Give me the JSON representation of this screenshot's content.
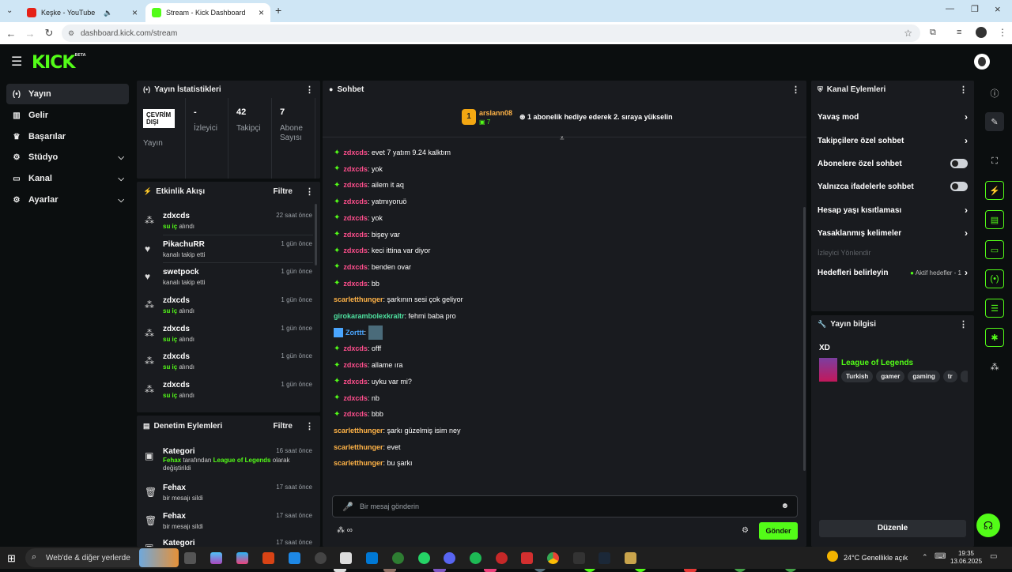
{
  "browser": {
    "tab1_title": "Keşke - YouTube",
    "tab2_title": "Stream - Kick Dashboard",
    "url": "dashboard.kick.com/stream"
  },
  "header": {
    "logo": "KICK",
    "logo_badge": "BETA"
  },
  "sidebar": {
    "items": [
      {
        "label": "Yayın",
        "icon": "broadcast-icon"
      },
      {
        "label": "Gelir",
        "icon": "chart-icon"
      },
      {
        "label": "Başarılar",
        "icon": "trophy-icon"
      },
      {
        "label": "Stüdyo",
        "icon": "gear-icon"
      },
      {
        "label": "Kanal",
        "icon": "screen-icon"
      },
      {
        "label": "Ayarlar",
        "icon": "gear-icon"
      }
    ]
  },
  "stats": {
    "title": "Yayın İstatistikleri",
    "status_badge": "ÇEVRİM DIŞI",
    "stream_label": "Yayın",
    "viewers_value": "-",
    "viewers_label": "İzleyici",
    "followers_value": "42",
    "followers_label": "Takipçi",
    "subs_value": "7",
    "subs_label": "Abone Sayısı"
  },
  "activity": {
    "title": "Etkinlik Akışı",
    "filter": "Filtre",
    "events": [
      {
        "name": "zdxcds",
        "sub_green": "su iç",
        "sub": " alındı",
        "time": "22 saat önce",
        "icon": "gift"
      },
      {
        "name": "PikachuRR",
        "sub_green": "",
        "sub": "kanalı takip etti",
        "time": "1 gün önce",
        "icon": "heart"
      },
      {
        "name": "swetpock",
        "sub_green": "",
        "sub": "kanalı takip etti",
        "time": "1 gün önce",
        "icon": "heart"
      },
      {
        "name": "zdxcds",
        "sub_green": "su iç",
        "sub": " alındı",
        "time": "1 gün önce",
        "icon": "gift"
      },
      {
        "name": "zdxcds",
        "sub_green": "su iç",
        "sub": " alındı",
        "time": "1 gün önce",
        "icon": "gift"
      },
      {
        "name": "zdxcds",
        "sub_green": "su iç",
        "sub": " alındı",
        "time": "1 gün önce",
        "icon": "gift"
      },
      {
        "name": "zdxcds",
        "sub_green": "su iç",
        "sub": " alındı",
        "time": "1 gün önce",
        "icon": "gift"
      }
    ]
  },
  "moderation": {
    "title": "Denetim Eylemleri",
    "filter": "Filtre",
    "items": [
      {
        "name": "Kategori",
        "time": "16 saat önce",
        "l1_a": "Fehax",
        "l1_b": " tarafından ",
        "l1_c": "League of Legends",
        "l1_d": " olarak",
        "l2": "değiştirildi"
      },
      {
        "name": "Fehax",
        "time": "17 saat önce",
        "l2": "bir mesajı sildi"
      },
      {
        "name": "Fehax",
        "time": "17 saat önce",
        "l2": "bir mesajı sildi"
      },
      {
        "name": "Kategori",
        "time": "17 saat önce",
        "l2": ""
      }
    ]
  },
  "chat": {
    "title": "Sohbet",
    "pinned_rank": "1",
    "pinned_user": "arslann08",
    "pinned_count": "7",
    "pinned_text": "1 abonelik hediye ederek 2. sıraya yükselin",
    "messages": [
      {
        "user": "zdxcds",
        "text": ": evet 7 yatım 9.24 kalktım",
        "color": "pink",
        "badge": true
      },
      {
        "user": "zdxcds",
        "text": ": yok",
        "color": "pink",
        "badge": true
      },
      {
        "user": "zdxcds",
        "text": ": ailem it aq",
        "color": "pink",
        "badge": true
      },
      {
        "user": "zdxcds",
        "text": ": yatmıyoruö",
        "color": "pink",
        "badge": true
      },
      {
        "user": "zdxcds",
        "text": ": yok",
        "color": "pink",
        "badge": true
      },
      {
        "user": "zdxcds",
        "text": ": bişey var",
        "color": "pink",
        "badge": true
      },
      {
        "user": "zdxcds",
        "text": ": keci ittina var diyor",
        "color": "pink",
        "badge": true
      },
      {
        "user": "zdxcds",
        "text": ": benden ovar",
        "color": "pink",
        "badge": true
      },
      {
        "user": "zdxcds",
        "text": ": bb",
        "color": "pink",
        "badge": true
      },
      {
        "user": "scarletthunger",
        "text": ": şarkının sesi çok geliyor",
        "color": "orange",
        "badge": false
      },
      {
        "user": "girokarambolexkraltr",
        "text": ": fehmi baba pro",
        "color": "green",
        "badge": false
      },
      {
        "user": "Zorttt",
        "text": ":",
        "color": "blue",
        "badge": false
      },
      {
        "user": "zdxcds",
        "text": ": offf",
        "color": "pink",
        "badge": true
      },
      {
        "user": "zdxcds",
        "text": ": allame ıra",
        "color": "pink",
        "badge": true
      },
      {
        "user": "zdxcds",
        "text": ": uyku var mi?",
        "color": "pink",
        "badge": true
      },
      {
        "user": "zdxcds",
        "text": ": nb",
        "color": "pink",
        "badge": true
      },
      {
        "user": "zdxcds",
        "text": ": bbb",
        "color": "pink",
        "badge": true
      },
      {
        "user": "scarletthunger",
        "text": ": şarkı güzelmiş isim ney",
        "color": "orange",
        "badge": false
      },
      {
        "user": "scarletthunger",
        "text": ": evet",
        "color": "orange",
        "badge": false
      },
      {
        "user": "scarletthunger",
        "text": ": bu şarkı",
        "color": "orange",
        "badge": false
      }
    ],
    "placeholder": "Bir mesaj gönderin",
    "send": "Gönder"
  },
  "channel_actions": {
    "title": "Kanal Eylemleri",
    "slow": "Yavaş mod",
    "followers_only": "Takipçilere özel sohbet",
    "subs_only": "Abonelere özel sohbet",
    "emotes_only": "Yalnızca ifadelerle sohbet",
    "age": "Hesap yaşı kısıtlaması",
    "banned": "Yasaklanmış kelimeler",
    "viewer_goal": "İzleyici Yönlendir",
    "goals": "Hedefleri belirleyin",
    "goals_status": "Aktif hedefler - 1"
  },
  "stream_info": {
    "title": "Yayın bilgisi",
    "stream_title": "XD",
    "category": "League of Legends",
    "tags": [
      "Turkish",
      "gamer",
      "gaming",
      "tr"
    ],
    "edit": "Düzenle"
  },
  "taskbar": {
    "search": "Web'de & diğer yerlerde",
    "weather": "24°C  Genellikle açık",
    "time": "19:35",
    "date": "13.06.2025"
  }
}
